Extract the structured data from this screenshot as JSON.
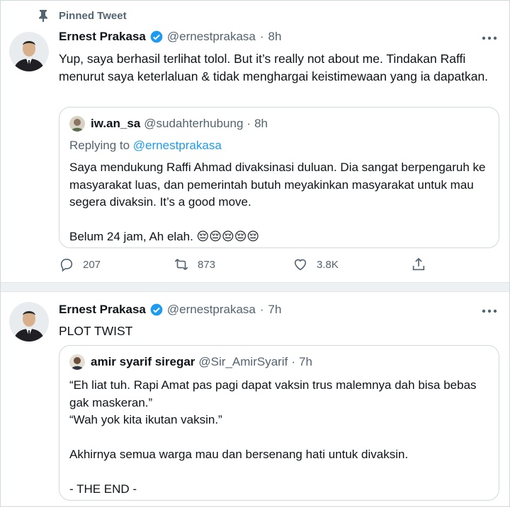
{
  "tweets": [
    {
      "pinned_label": "Pinned Tweet",
      "author_name": "Ernest Prakasa",
      "author_handle": "@ernestprakasa",
      "time": "8h",
      "text": "Yup, saya berhasil terlihat tolol. But it’s really not about me. Tindakan Raffi menurut saya keterlaluan & tidak menghargai keistimewaan yang ia dapatkan.",
      "quote": {
        "author_name": "iw.an_sa",
        "author_handle": "@sudahterhubung",
        "time": "8h",
        "replying_prefix": "Replying to",
        "replying_handle": "@ernestprakasa",
        "text": "Saya mendukung Raffi Ahmad divaksinasi duluan. Dia sangat berpengaruh ke masyarakat luas, dan pemerintah butuh meyakinkan masyarakat untuk mau segera divaksin. It’s a good move.\n\nBelum 24 jam, Ah elah. 😔😔😔😔😔"
      },
      "actions": {
        "replies": "207",
        "retweets": "873",
        "likes": "3.8K"
      }
    },
    {
      "author_name": "Ernest Prakasa",
      "author_handle": "@ernestprakasa",
      "time": "7h",
      "text": "PLOT TWIST",
      "quote": {
        "author_name": "amir syarif siregar",
        "author_handle": "@Sir_AmirSyarif",
        "time": "7h",
        "text": "“Eh liat tuh. Rapi Amat pas pagi dapat vaksin trus malemnya dah bisa bebas gak maskeran.”\n“Wah yok kita ikutan vaksin.”\n\nAkhirnya semua warga mau dan bersenang hati untuk divaksin.\n\n- THE END -"
      }
    }
  ],
  "icons": [
    "pin-icon",
    "verified-badge-icon",
    "more-options-icon",
    "reply-icon",
    "retweet-icon",
    "like-icon",
    "share-icon"
  ],
  "colors": {
    "accent": "#1d9bf0",
    "secondary_text": "#536471",
    "border": "#cfd9de"
  }
}
